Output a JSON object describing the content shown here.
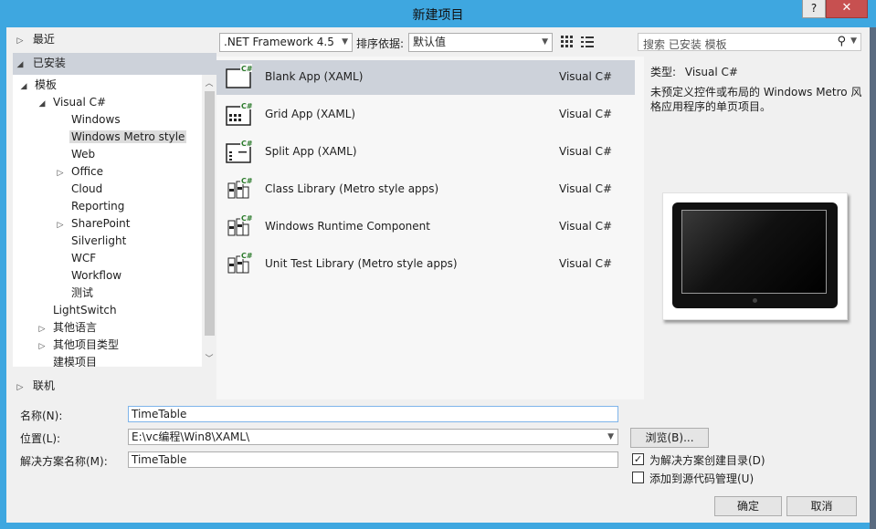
{
  "window": {
    "title": "新建项目",
    "help_label": "?",
    "close_label": "✕"
  },
  "tree": {
    "recent": "最近",
    "installed": "已安装",
    "items": [
      {
        "label": "模板",
        "arrow": "◢",
        "indent": 0
      },
      {
        "label": "Visual C#",
        "arrow": "◢",
        "indent": 1
      },
      {
        "label": "Windows",
        "arrow": "",
        "indent": 2
      },
      {
        "label": "Windows Metro style",
        "arrow": "",
        "indent": 2
      },
      {
        "label": "Web",
        "arrow": "",
        "indent": 2
      },
      {
        "label": "Office",
        "arrow": "▷",
        "indent": 2
      },
      {
        "label": "Cloud",
        "arrow": "",
        "indent": 2
      },
      {
        "label": "Reporting",
        "arrow": "",
        "indent": 2
      },
      {
        "label": "SharePoint",
        "arrow": "▷",
        "indent": 2
      },
      {
        "label": "Silverlight",
        "arrow": "",
        "indent": 2
      },
      {
        "label": "WCF",
        "arrow": "",
        "indent": 2
      },
      {
        "label": "Workflow",
        "arrow": "",
        "indent": 2
      },
      {
        "label": "测试",
        "arrow": "",
        "indent": 2
      },
      {
        "label": "LightSwitch",
        "arrow": "",
        "indent": 1
      },
      {
        "label": "其他语言",
        "arrow": "▷",
        "indent": 1
      },
      {
        "label": "其他项目类型",
        "arrow": "▷",
        "indent": 1
      },
      {
        "label": "建模项目",
        "arrow": "",
        "indent": 1
      }
    ],
    "online": "联机"
  },
  "toolbar": {
    "framework": ".NET Framework 4.5",
    "sort_label": "排序依据:",
    "sort_value": "默认值"
  },
  "templates": [
    {
      "name": "Blank App (XAML)",
      "lang": "Visual C#"
    },
    {
      "name": "Grid App (XAML)",
      "lang": "Visual C#"
    },
    {
      "name": "Split App (XAML)",
      "lang": "Visual C#"
    },
    {
      "name": "Class Library (Metro style apps)",
      "lang": "Visual C#"
    },
    {
      "name": "Windows Runtime Component",
      "lang": "Visual C#"
    },
    {
      "name": "Unit Test Library (Metro style apps)",
      "lang": "Visual C#"
    }
  ],
  "details": {
    "search_placeholder": "搜索 已安装 模板",
    "type_label": "类型:",
    "type_value": "Visual C#",
    "description": "未预定义控件或布局的 Windows Metro 风格应用程序的单页项目。"
  },
  "form": {
    "name_label": "名称(N):",
    "name_value": "TimeTable",
    "location_label": "位置(L):",
    "location_value": "E:\\vc编程\\Win8\\XAML\\",
    "solution_label": "解决方案名称(M):",
    "solution_value": "TimeTable",
    "browse_label": "浏览(B)...",
    "create_dir_label": "为解决方案创建目录(D)",
    "create_dir_checked": "✓",
    "source_control_label": "添加到源代码管理(U)",
    "ok_label": "确定",
    "cancel_label": "取消"
  }
}
